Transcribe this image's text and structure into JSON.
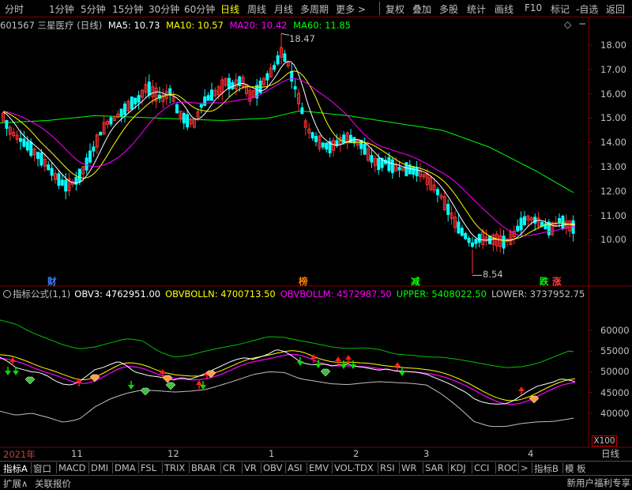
{
  "toolbar": {
    "timeframes": [
      "分时",
      "1分钟",
      "5分钟",
      "15分钟",
      "30分钟",
      "60分钟",
      "日线",
      "周线",
      "月线",
      "多周期",
      "更多 >"
    ],
    "active_timeframe": "日线",
    "buttons": [
      "复权",
      "叠加",
      "多股",
      "统计",
      "画线",
      "F10",
      "标记",
      "-自选",
      "返回"
    ]
  },
  "main_header": {
    "stock": "601567 三星医疗 (日线)",
    "ma5": "MA5: 10.73",
    "ma10": "MA10: 10.57",
    "ma20": "MA20: 10.42",
    "ma60": "MA60: 11.85",
    "diamond_icon": "◇",
    "minus_icon": "−"
  },
  "indicator_header": {
    "name": "指标公式(1,1)",
    "obv3": "OBV3: 4762951.00",
    "obvbolln": "OBVBOLLN: 4700713.50",
    "obvbollm": "OBVBOLLM: 4572987.50",
    "upper": "UPPER: 5408022.50",
    "lower": "LOWER: 3737952.75"
  },
  "price_axis": [
    "18.00",
    "17.00",
    "16.00",
    "15.00",
    "14.00",
    "13.00",
    "12.00",
    "11.00",
    "10.00"
  ],
  "indicator_axis": [
    "60000",
    "55000",
    "50000",
    "45000",
    "40000"
  ],
  "annotations": {
    "high": "18.47",
    "low": "8.54"
  },
  "events": [
    {
      "label": "财",
      "color": "#4080ff"
    },
    {
      "label": "榜",
      "color": "#ff8000"
    },
    {
      "label": "减",
      "color": "#00ff00"
    },
    {
      "label": "跌",
      "color": "#00ff00"
    },
    {
      "label": "涨",
      "color": "#ff4040"
    }
  ],
  "x_axis": {
    "year": "2021年",
    "months": [
      "11",
      "12",
      "1",
      "2",
      "3",
      "4"
    ]
  },
  "scale": "X100",
  "period_box": "日线",
  "bottom_tabs": [
    "指标A",
    "窗口",
    "MACD",
    "DMI",
    "DMA",
    "FSL",
    "TRIX",
    "BRAR",
    "CR",
    "VR",
    "OBV",
    "ASI",
    "EMV",
    "VOL-TDX",
    "RSI",
    "WR",
    "SAR",
    "KDJ",
    "CCI",
    "ROC",
    ">",
    "指标B",
    "模 板"
  ],
  "status": {
    "expand": "扩展∧",
    "quote": "关联报价",
    "ad": "新用户福利专享"
  },
  "colors": {
    "up": "#ff3232",
    "down": "#00ffff",
    "ma5": "#ffffff",
    "ma10": "#ffff00",
    "ma20": "#ff00ff",
    "ma60": "#00ff00",
    "axis": "#800000"
  }
}
